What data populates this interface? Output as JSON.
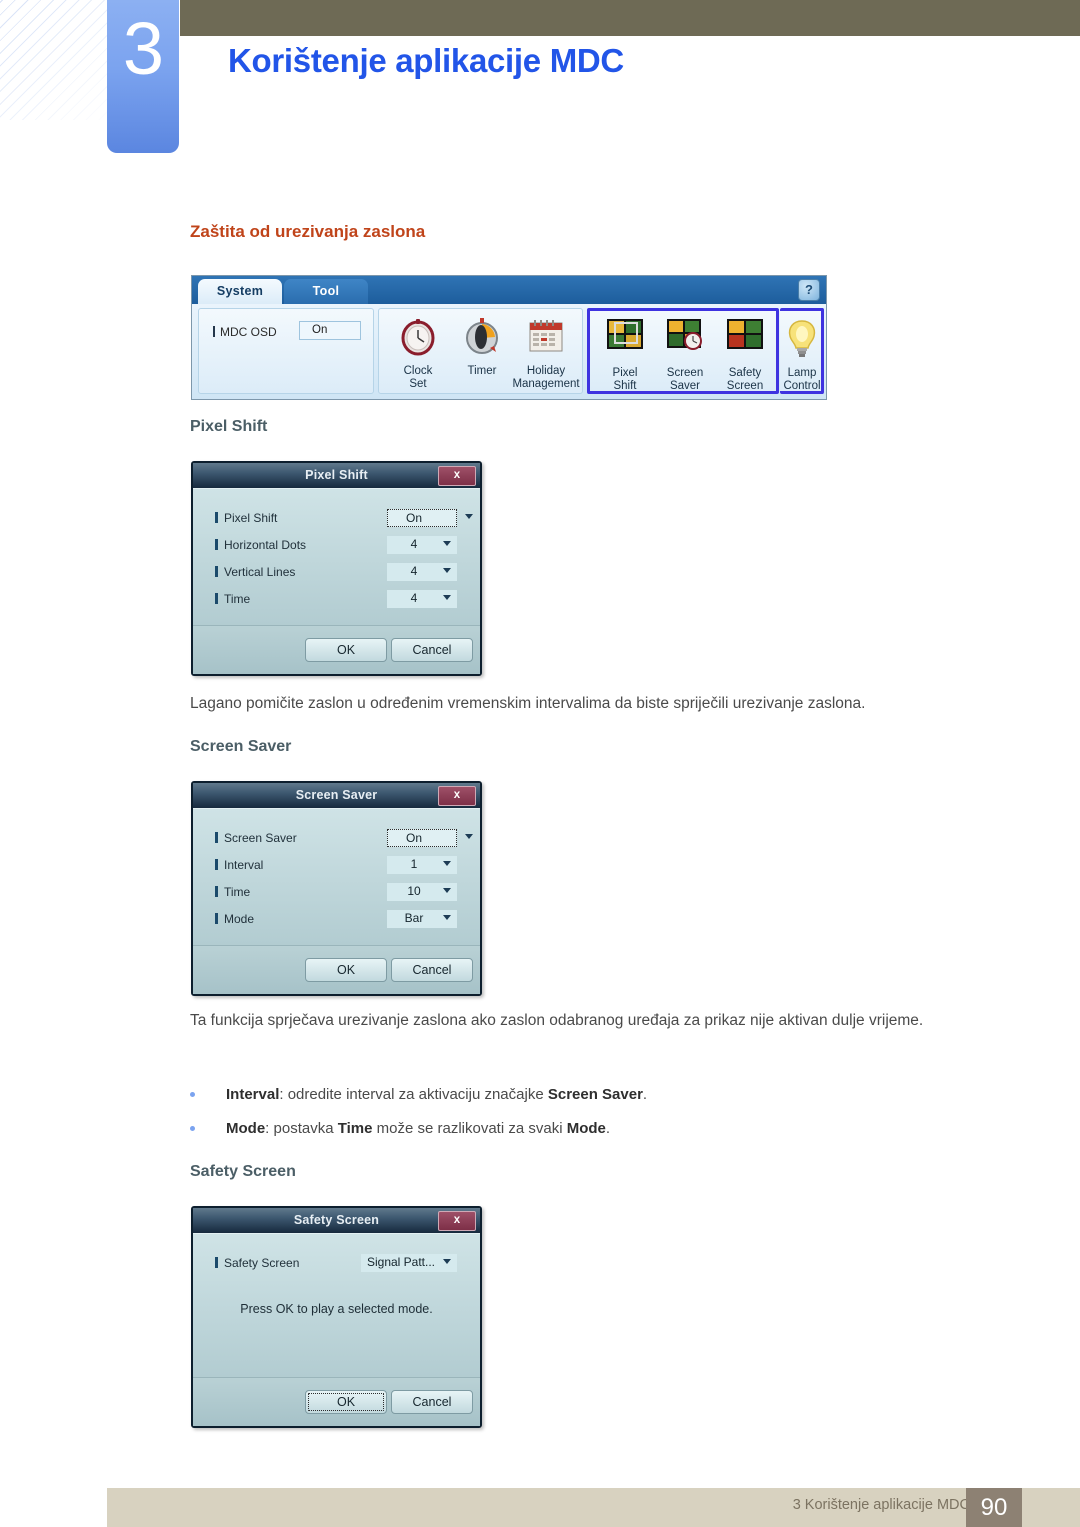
{
  "header": {
    "chapter_number": "3",
    "chapter_title": "Korištenje aplikacije MDC"
  },
  "section": {
    "title": "Zaštita od urezivanja zaslona"
  },
  "toolbar": {
    "tabs": [
      {
        "label": "System",
        "active": true
      },
      {
        "label": "Tool",
        "active": false
      }
    ],
    "help_icon": "?",
    "osd": {
      "label": "MDC OSD",
      "value": "On"
    },
    "groups": [
      {
        "name": "schedule",
        "items": [
          {
            "line1": "Clock",
            "line2": "Set",
            "icon": "clock-icon"
          },
          {
            "line1": "Timer",
            "line2": "",
            "icon": "timer-icon"
          },
          {
            "line1": "Holiday",
            "line2": "Management",
            "icon": "calendar-icon"
          }
        ]
      },
      {
        "name": "screen-burn-protection",
        "highlighted": true,
        "items": [
          {
            "line1": "Pixel",
            "line2": "Shift",
            "icon": "pixel-shift-icon"
          },
          {
            "line1": "Screen",
            "line2": "Saver",
            "icon": "screen-saver-icon"
          },
          {
            "line1": "Safety",
            "line2": "Screen",
            "icon": "safety-screen-icon"
          }
        ]
      },
      {
        "name": "lamp",
        "items": [
          {
            "line1": "Lamp",
            "line2": "Control",
            "icon": "lamp-icon"
          }
        ]
      }
    ]
  },
  "pixel_shift": {
    "heading": "Pixel Shift",
    "dialog": {
      "title": "Pixel Shift",
      "close_label": "x",
      "fields": [
        {
          "label": "Pixel Shift",
          "value": "On",
          "focused": true
        },
        {
          "label": "Horizontal Dots",
          "value": "4",
          "focused": false
        },
        {
          "label": "Vertical Lines",
          "value": "4",
          "focused": false
        },
        {
          "label": "Time",
          "value": "4",
          "focused": false
        }
      ],
      "ok_label": "OK",
      "cancel_label": "Cancel"
    },
    "description": "Lagano pomičite zaslon u određenim vremenskim intervalima da biste spriječili urezivanje zaslona."
  },
  "screen_saver": {
    "heading": "Screen Saver",
    "dialog": {
      "title": "Screen Saver",
      "close_label": "x",
      "fields": [
        {
          "label": "Screen Saver",
          "value": "On",
          "focused": true
        },
        {
          "label": "Interval",
          "value": "1",
          "focused": false
        },
        {
          "label": "Time",
          "value": "10",
          "focused": false
        },
        {
          "label": "Mode",
          "value": "Bar",
          "focused": false
        }
      ],
      "ok_label": "OK",
      "cancel_label": "Cancel"
    },
    "description": "Ta funkcija sprječava urezivanje zaslona ako zaslon odabranog uređaja za prikaz nije aktivan dulje vrijeme.",
    "bullets": [
      {
        "term": "Interval",
        "rest_a": ": odredite interval za aktivaciju značajke ",
        "bold_b": "Screen Saver",
        "rest_b": "."
      },
      {
        "term": "Mode",
        "rest_a": ": postavka ",
        "bold_b": "Time",
        "rest_b": " može se razlikovati za svaki ",
        "bold_c": "Mode",
        "rest_c": "."
      }
    ]
  },
  "safety_screen": {
    "heading": "Safety Screen",
    "dialog": {
      "title": "Safety Screen",
      "close_label": "x",
      "field_label": "Safety Screen",
      "field_value": "Signal Patt...",
      "note": "Press OK to play a selected mode.",
      "ok_label": "OK",
      "cancel_label": "Cancel"
    }
  },
  "footer": {
    "text": "3 Korištenje aplikacije MDC",
    "page": "90"
  },
  "colors": {
    "chapter_blue": "#2255e8",
    "section_orange": "#c0441a",
    "subheading_slate": "#4b5e66",
    "olive": "#6e6a55",
    "tab_blue": "#7ba3ef",
    "footer_tan": "#d8d2c0",
    "footer_page_brown": "#8d8173",
    "highlight_violet": "#3e33e0"
  }
}
